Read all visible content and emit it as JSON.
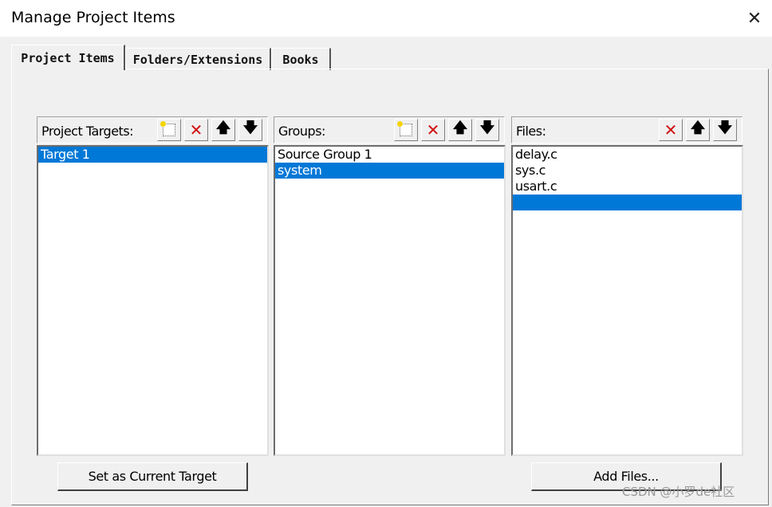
{
  "window": {
    "title": "Manage Project Items",
    "close_glyph": "✕"
  },
  "tabs": [
    {
      "label": "Project Items",
      "active": true
    },
    {
      "label": "Folders/Extensions",
      "active": false
    },
    {
      "label": "Books",
      "active": false
    }
  ],
  "targets": {
    "header": "Project Targets:",
    "items": [
      {
        "label": "Target 1",
        "selected": true
      }
    ]
  },
  "groups": {
    "header": "Groups:",
    "items": [
      {
        "label": "Source Group 1",
        "selected": false
      },
      {
        "label": "system",
        "selected": true
      }
    ]
  },
  "files": {
    "header": "Files:",
    "items": [
      {
        "label": "delay.c",
        "selected": false
      },
      {
        "label": "sys.c",
        "selected": false
      },
      {
        "label": "usart.c",
        "selected": false
      },
      {
        "label": "",
        "selected": true
      }
    ]
  },
  "toolbar_icons": {
    "new": "new-icon",
    "delete": "✕",
    "up": "🡅",
    "down": "🡇"
  },
  "buttons": {
    "set_current": "Set as Current Target",
    "add_files": "Add Files..."
  },
  "watermark": "CSDN @小罗de社区",
  "colors": {
    "selection": "#0078d7",
    "delete_icon": "#d01010"
  }
}
